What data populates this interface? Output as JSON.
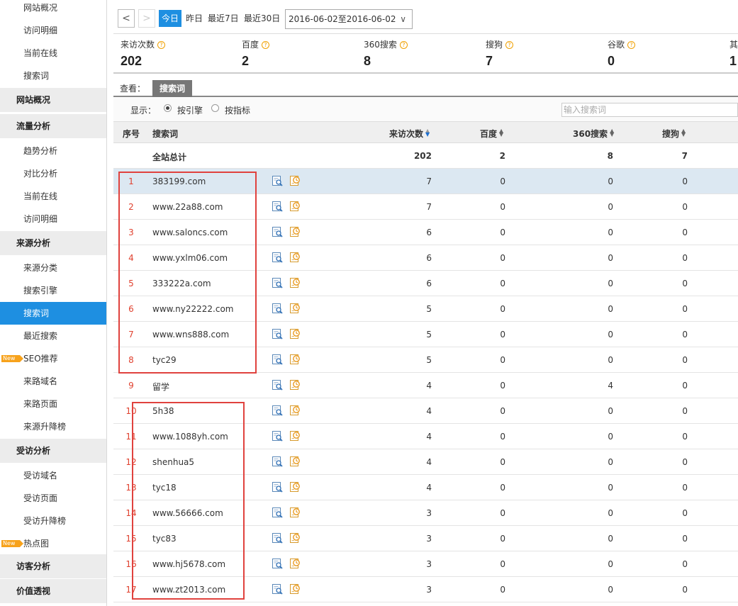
{
  "sidebar": {
    "top_items": [
      "网站概况",
      "访问明细",
      "当前在线",
      "搜索词"
    ],
    "groups": [
      {
        "label": "网站概况",
        "items": []
      },
      {
        "label": "流量分析",
        "items": [
          "趋势分析",
          "对比分析",
          "当前在线",
          "访问明细"
        ]
      },
      {
        "label": "来源分析",
        "items": [
          "来源分类",
          "搜索引擎",
          "搜索词",
          "最近搜索",
          "SEO推荐",
          "来路域名",
          "来路页面",
          "来源升降榜"
        ]
      },
      {
        "label": "受访分析",
        "items": [
          "受访域名",
          "受访页面",
          "受访升降榜",
          "热点图"
        ]
      },
      {
        "label": "访客分析",
        "items": []
      },
      {
        "label": "价值透视",
        "items": []
      }
    ],
    "active_item": "搜索词",
    "new_badge": "New"
  },
  "toolbar": {
    "prev_arrow": "<",
    "next_arrow": ">",
    "ranges": [
      "今日",
      "昨日",
      "最近7日",
      "最近30日"
    ],
    "active_range": "今日",
    "date_range": "2016-06-02至2016-06-02",
    "dropdown_arrow": "∨"
  },
  "summary": [
    {
      "label": "来访次数",
      "value": "202"
    },
    {
      "label": "百度",
      "value": "2"
    },
    {
      "label": "360搜索",
      "value": "8"
    },
    {
      "label": "搜狗",
      "value": "7"
    },
    {
      "label": "谷歌",
      "value": "0"
    },
    {
      "label": "其",
      "value": "1"
    }
  ],
  "help_mark": "?",
  "view": {
    "label": "查看：",
    "tab": "搜索词"
  },
  "display": {
    "label": "显示：",
    "options": [
      "按引擎",
      "按指标"
    ],
    "selected": "按引擎",
    "search_placeholder": "输入搜索词"
  },
  "table": {
    "headers": {
      "index": "序号",
      "keyword": "搜索词",
      "visits": "来访次数",
      "baidu": "百度",
      "s360": "360搜索",
      "sogou": "搜狗"
    },
    "total": {
      "keyword": "全站总计",
      "visits": "202",
      "baidu": "2",
      "s360": "8",
      "sogou": "7"
    },
    "rows": [
      {
        "index": "1",
        "keyword": "383199.com",
        "visits": "7",
        "baidu": "0",
        "s360": "0",
        "sogou": "0"
      },
      {
        "index": "2",
        "keyword": "www.22a88.com",
        "visits": "7",
        "baidu": "0",
        "s360": "0",
        "sogou": "0"
      },
      {
        "index": "3",
        "keyword": "www.saloncs.com",
        "visits": "6",
        "baidu": "0",
        "s360": "0",
        "sogou": "0"
      },
      {
        "index": "4",
        "keyword": "www.yxlm06.com",
        "visits": "6",
        "baidu": "0",
        "s360": "0",
        "sogou": "0"
      },
      {
        "index": "5",
        "keyword": "333222a.com",
        "visits": "6",
        "baidu": "0",
        "s360": "0",
        "sogou": "0"
      },
      {
        "index": "6",
        "keyword": "www.ny22222.com",
        "visits": "5",
        "baidu": "0",
        "s360": "0",
        "sogou": "0"
      },
      {
        "index": "7",
        "keyword": "www.wns888.com",
        "visits": "5",
        "baidu": "0",
        "s360": "0",
        "sogou": "0"
      },
      {
        "index": "8",
        "keyword": "tyc29",
        "visits": "5",
        "baidu": "0",
        "s360": "0",
        "sogou": "0"
      },
      {
        "index": "9",
        "keyword": "留学",
        "visits": "4",
        "baidu": "0",
        "s360": "4",
        "sogou": "0"
      },
      {
        "index": "10",
        "keyword": "5h38",
        "visits": "4",
        "baidu": "0",
        "s360": "0",
        "sogou": "0"
      },
      {
        "index": "11",
        "keyword": "www.1088yh.com",
        "visits": "4",
        "baidu": "0",
        "s360": "0",
        "sogou": "0"
      },
      {
        "index": "12",
        "keyword": "shenhua5",
        "visits": "4",
        "baidu": "0",
        "s360": "0",
        "sogou": "0"
      },
      {
        "index": "13",
        "keyword": "tyc18",
        "visits": "4",
        "baidu": "0",
        "s360": "0",
        "sogou": "0"
      },
      {
        "index": "14",
        "keyword": "www.56666.com",
        "visits": "3",
        "baidu": "0",
        "s360": "0",
        "sogou": "0"
      },
      {
        "index": "15",
        "keyword": "tyc83",
        "visits": "3",
        "baidu": "0",
        "s360": "0",
        "sogou": "0"
      },
      {
        "index": "16",
        "keyword": "www.hj5678.com",
        "visits": "3",
        "baidu": "0",
        "s360": "0",
        "sogou": "0"
      },
      {
        "index": "17",
        "keyword": "www.zt2013.com",
        "visits": "3",
        "baidu": "0",
        "s360": "0",
        "sogou": "0"
      }
    ],
    "row_icons": [
      "search-page-icon",
      "history-clock-icon"
    ]
  },
  "colors": {
    "accent": "#1e8fe1",
    "index_red": "#e0412f",
    "highlight_row": "#dce8f2",
    "annotation_box": "#e0423e"
  }
}
